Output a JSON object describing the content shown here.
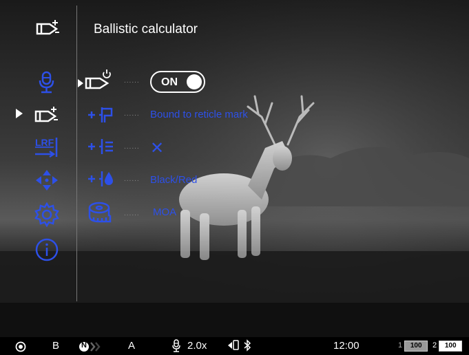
{
  "header": {
    "title": "Ballistic calculator",
    "icon": "bullet-plus-icon"
  },
  "sidebar": {
    "items": [
      {
        "name": "microphone-icon",
        "active": false
      },
      {
        "name": "bullet-plus-icon",
        "active": true
      },
      {
        "name": "lrf-icon",
        "label": "LRF",
        "active": false
      },
      {
        "name": "crosshair-arrows-icon",
        "active": false
      },
      {
        "name": "gear-icon",
        "active": false
      },
      {
        "name": "info-icon",
        "active": false
      }
    ]
  },
  "options": [
    {
      "icon": "bullet-power-icon",
      "value": "ON",
      "type": "toggle"
    },
    {
      "icon": "reticle-bound-icon",
      "value": "Bound to reticle mark"
    },
    {
      "icon": "reticle-list-icon",
      "value": "✕"
    },
    {
      "icon": "reticle-color-icon",
      "value": "Black/Red"
    },
    {
      "icon": "tape-measure-icon",
      "value": "MOA"
    }
  ],
  "status": {
    "mode_letter": "B",
    "nav_badge": "N",
    "auto_letter": "A",
    "zoom": "2.0x",
    "time": "12:00",
    "battery1": {
      "index": "1",
      "level": "100"
    },
    "battery2": {
      "index": "2",
      "level": "100"
    }
  },
  "colors": {
    "accent": "#2d50e8",
    "background": "#000000",
    "text": "#ffffff"
  }
}
